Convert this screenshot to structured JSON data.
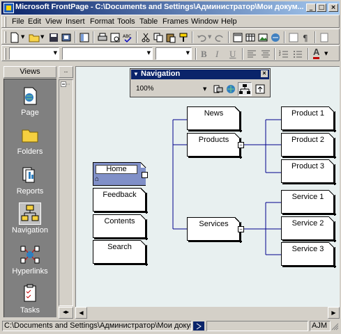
{
  "window": {
    "title": "Microsoft FrontPage - C:\\Documents and Settings\\Администратор\\Мои докум...",
    "minimize_label": "_",
    "maximize_label": "□",
    "close_label": "×"
  },
  "menu": {
    "items": [
      "File",
      "Edit",
      "View",
      "Insert",
      "Format",
      "Tools",
      "Table",
      "Frames",
      "Window",
      "Help"
    ]
  },
  "format_toolbar": {
    "style_value": "",
    "font_value": "",
    "size_value": "",
    "bold_label": "B",
    "italic_label": "I",
    "underline_label": "U",
    "font_color_label": "A"
  },
  "views_bar": {
    "header": "Views",
    "items": [
      {
        "label": "Page",
        "icon": "page-view-icon"
      },
      {
        "label": "Folders",
        "icon": "folders-view-icon"
      },
      {
        "label": "Reports",
        "icon": "reports-view-icon"
      },
      {
        "label": "Navigation",
        "icon": "navigation-view-icon",
        "selected": true
      },
      {
        "label": "Hyperlinks",
        "icon": "hyperlinks-view-icon"
      },
      {
        "label": "Tasks",
        "icon": "tasks-view-icon"
      }
    ]
  },
  "folder_strip": {
    "expand_label": ".."
  },
  "navigation_toolbar": {
    "title": "Navigation",
    "close_label": "×",
    "zoom": "100%"
  },
  "site_structure": {
    "home": "Home",
    "top_level": [
      "Feedback",
      "Contents",
      "Search"
    ],
    "level1": [
      "News",
      "Products",
      "Services"
    ],
    "products": [
      "Product 1",
      "Product 2",
      "Product 3"
    ],
    "services": [
      "Service 1",
      "Service 2",
      "Service 3"
    ]
  },
  "status_bar": {
    "path": "C:\\Documents and Settings\\Администратор\\Мои документы\\",
    "initials": "AJM"
  },
  "colors": {
    "titlebar_start": "#0a246a",
    "titlebar_end": "#a6caf0",
    "canvas_bg": "#e8f0f0",
    "connector": "#00008b",
    "home_box": "#8090c8"
  }
}
